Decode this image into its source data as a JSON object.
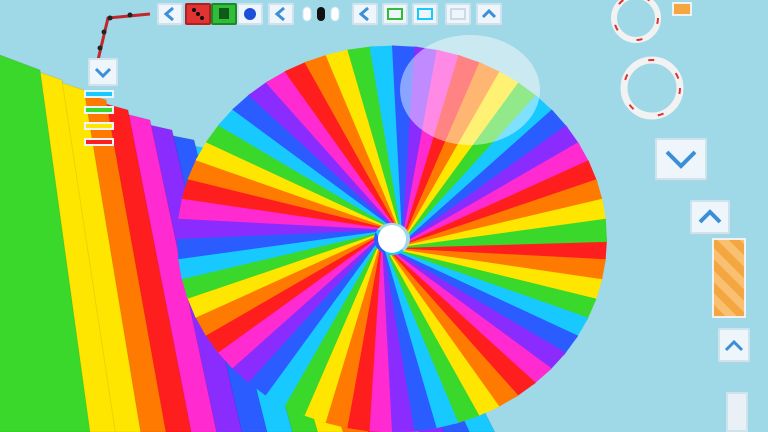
{
  "scene": {
    "sky_color": "#9fd8e6",
    "rainbow_palette": [
      "#ff1e1e",
      "#ff7a00",
      "#ffe600",
      "#39d82a",
      "#18c9ff",
      "#2a5cff",
      "#8b2cff",
      "#ff2ad0"
    ],
    "icons": [
      "chevron-left-icon",
      "dice-icon",
      "green-cube-icon",
      "blue-circle-icon",
      "chevron-left-icon",
      "capsule-icon",
      "chevron-left-icon",
      "square-outline-icon",
      "chevron-down-icon",
      "chevron-up-icon",
      "ring-icon"
    ]
  }
}
